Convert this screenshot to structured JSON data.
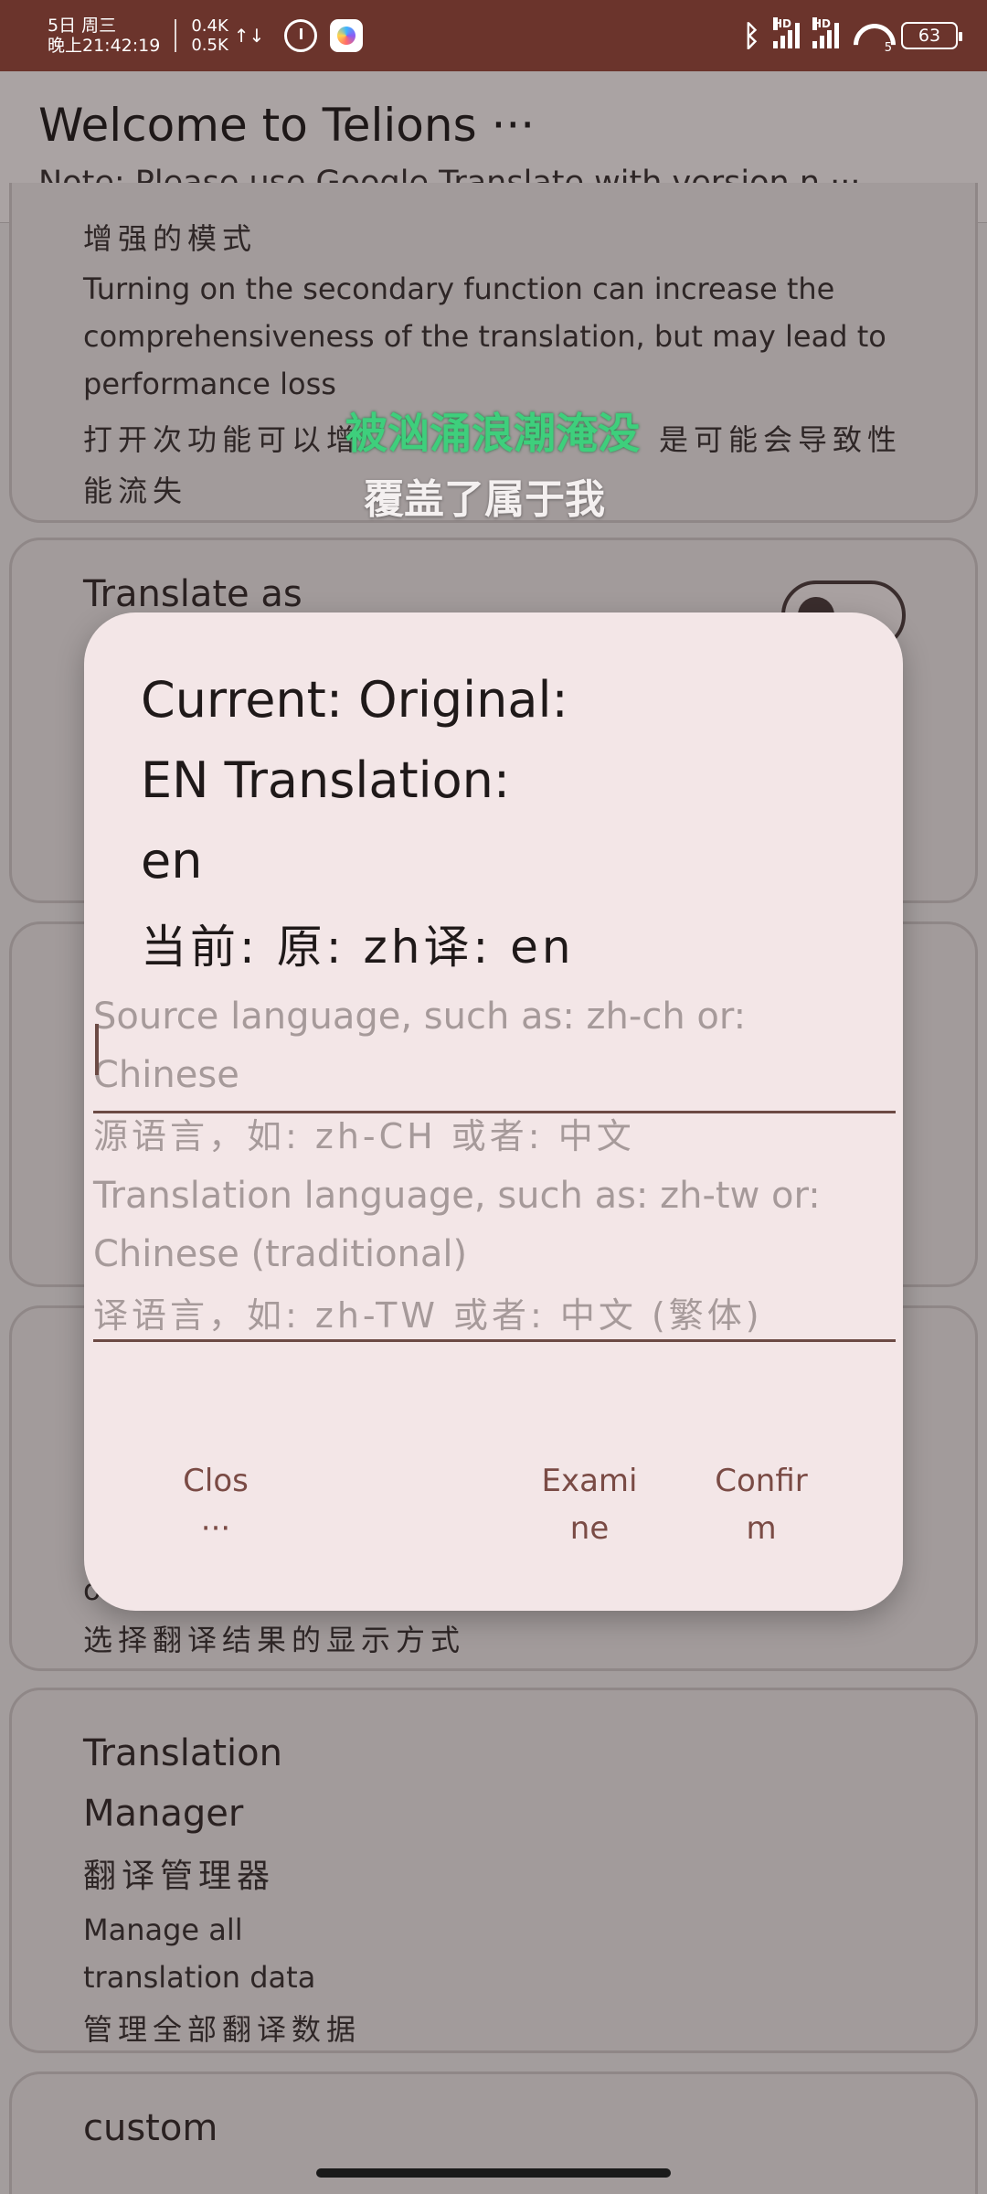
{
  "status_bar": {
    "date_line1": "5日 周三",
    "date_line2": "晚上21:42:19",
    "speed_up": "0.4K",
    "speed_down": "0.5K",
    "arrows": "↑↓",
    "bluetooth_icon": "bluetooth-icon",
    "signal1_label": "HD",
    "signal2_label": "HD",
    "wifi_label": "5",
    "battery": "63"
  },
  "header": {
    "title": "Welcome to Telions ···",
    "note": "Note: Please use Google Translate with version n ···"
  },
  "cards": {
    "enhanced": {
      "title_zh": "增强的模式",
      "desc_en": "Turning on the secondary function can increase the comprehensiveness of the translation, but may lead to performance loss",
      "desc_zh_1": "打开次功能可以增",
      "desc_zh_2": "是可能会导致性",
      "desc_zh_3": "能流失"
    },
    "translate_as": {
      "title": "Translate as"
    },
    "display": {
      "desc_en_tail": "o",
      "desc_zh": "选择翻译结果的显示方式"
    },
    "manager": {
      "title_1": "Translation",
      "title_2": "Manager",
      "title_zh": "翻译管理器",
      "desc_1": "Manage all",
      "desc_2": "translation data",
      "desc_zh": "管理全部翻译数据"
    },
    "custom": {
      "title": "custom"
    }
  },
  "lyrics": {
    "line1": "被汹涌浪潮淹没",
    "line2": "覆盖了属于我"
  },
  "dialog": {
    "current_line1": "Current: Original:",
    "current_line2": "EN Translation:",
    "current_line3": "en",
    "current_zh": "当前: 原: zh译: en",
    "source_placeholder": "Source language, such as: zh-ch or: Chinese",
    "source_placeholder_zh": "源语言，如: zh-CH 或者: 中文",
    "target_placeholder_1": "Translation language, such as: zh-tw or:",
    "target_placeholder_2": "Chinese (traditional)",
    "target_placeholder_zh": "译语言，如: zh-TW 或者: 中文 (繁体)",
    "close_label": "Clos ···",
    "examine_label_1": "Exami",
    "examine_label_2": "ne",
    "confirm_label_1": "Confir",
    "confirm_label_2": "m"
  },
  "colors": {
    "status_bar": "#6b342c",
    "dialog_bg": "#f3e6e7",
    "accent": "#7a4b45",
    "lyric_green": "#3ecf7c"
  }
}
